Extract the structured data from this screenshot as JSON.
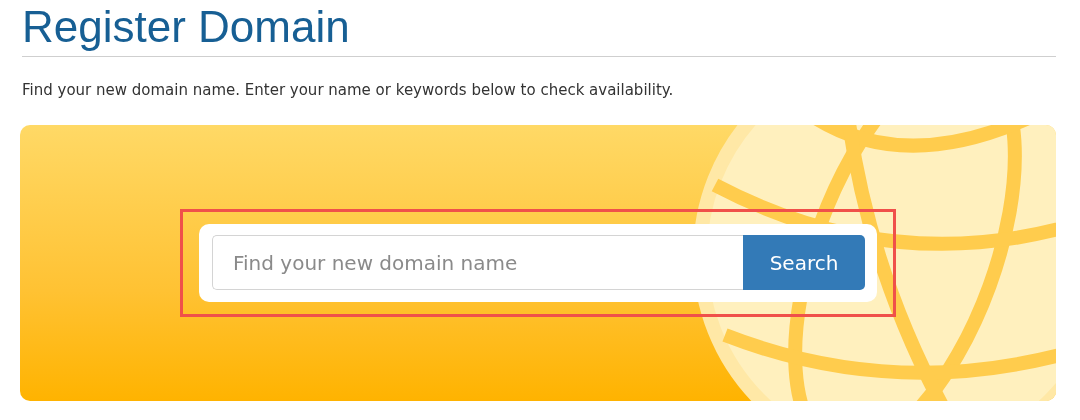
{
  "title": "Register Domain",
  "intro": "Find your new domain name. Enter your name or keywords below to check availability.",
  "search": {
    "placeholder": "Find your new domain name",
    "button": "Search",
    "highlighted": true
  }
}
